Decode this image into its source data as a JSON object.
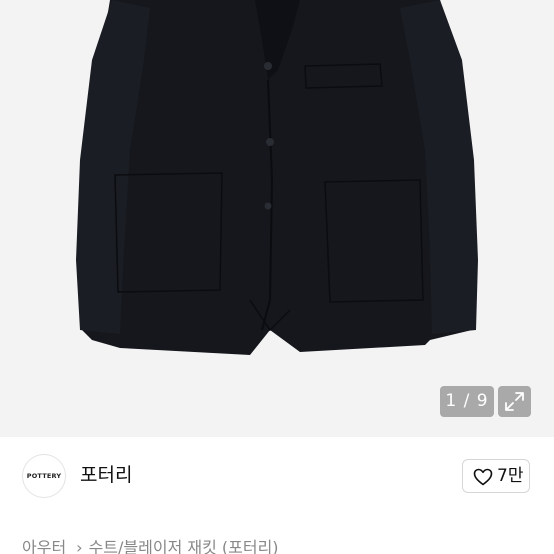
{
  "gallery": {
    "counter": "1 / 9",
    "expand_icon": "expand-diagonal-icon"
  },
  "seller": {
    "avatar_text": "POTTERY",
    "name": "포터리"
  },
  "like": {
    "icon": "heart-outline-icon",
    "count": "7만"
  },
  "breadcrumb": {
    "items": [
      "아우터",
      "수트/블레이저 재킷 (포터리)"
    ],
    "separator": "›"
  },
  "colors": {
    "jacket": "#15171d",
    "photo_background": "#f3f3f3",
    "overlay": "#8c8c8c"
  }
}
